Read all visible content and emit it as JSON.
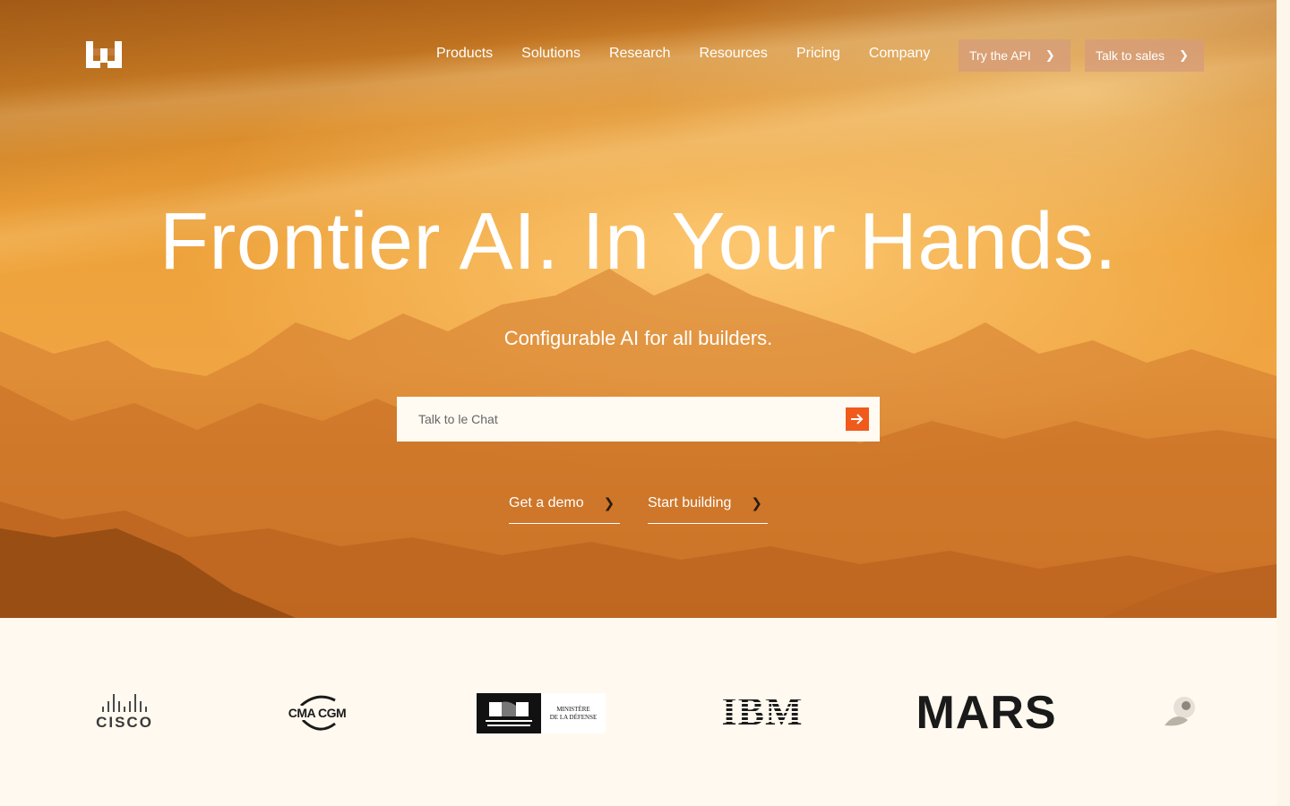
{
  "brand": {
    "logo_icon": "mistral-logo-icon"
  },
  "nav": {
    "items": [
      "Products",
      "Solutions",
      "Research",
      "Resources",
      "Pricing",
      "Company"
    ],
    "try_api": "Try the API",
    "talk_sales": "Talk to sales"
  },
  "hero": {
    "headline": "Frontier AI. In Your Hands.",
    "subline": "Configurable AI for all builders.",
    "chat_placeholder": "Talk to le Chat",
    "cta_demo": "Get a demo",
    "cta_build": "Start building"
  },
  "logos": {
    "cisco": "CISCO",
    "cma": "CMA CGM",
    "ministere_line1": "MINISTÈRE",
    "ministere_line2": "DE LA DÉFENSE",
    "ibm": "IBM",
    "mars": "MARS"
  },
  "colors": {
    "accent": "#f05a1a",
    "hero_orange": "#eea23a",
    "page_bg": "#fff9ef"
  }
}
